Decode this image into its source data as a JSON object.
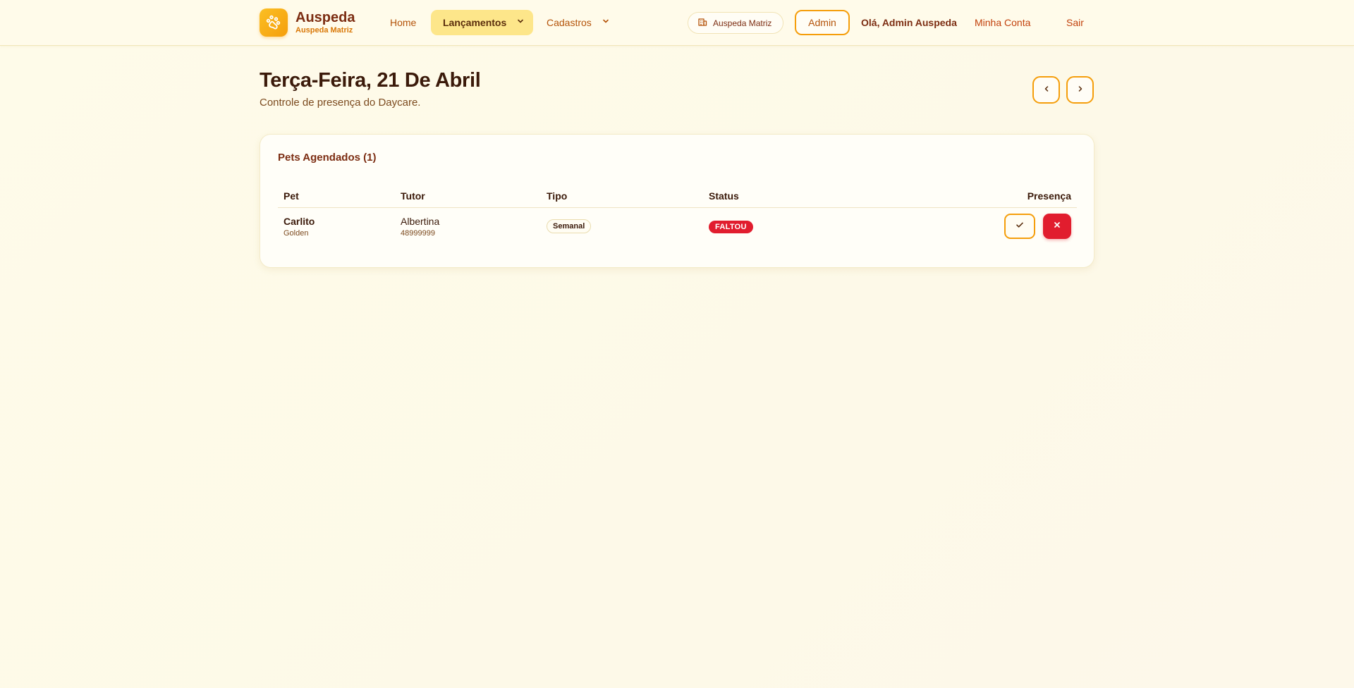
{
  "brand": {
    "name": "Auspeda",
    "subtitle": "Auspeda Matriz",
    "logo_icon": "paw-icon"
  },
  "nav": {
    "home": "Home",
    "lancamentos": "Lançamentos",
    "cadastros": "Cadastros"
  },
  "header": {
    "branch": "Auspeda Matriz",
    "role": "Admin",
    "greeting": "Olá, Admin Auspeda",
    "account": "Minha Conta",
    "logout": "Sair"
  },
  "page": {
    "title": "Terça-Feira, 21 De Abril",
    "subtitle": "Controle de presença do Daycare."
  },
  "card": {
    "title": "Pets Agendados (1)",
    "columns": {
      "pet": "Pet",
      "tutor": "Tutor",
      "type": "Tipo",
      "status": "Status",
      "presence": "Presença"
    },
    "rows": [
      {
        "pet_name": "Carlito",
        "pet_breed": "Golden",
        "tutor_name": "Albertina",
        "tutor_phone": "48999999",
        "type": "Semanal",
        "status": "FALTOU"
      }
    ]
  },
  "colors": {
    "accent": "#f59e0b",
    "accent_light": "#fde68a",
    "danger": "#e11d2e",
    "brand_text": "#7c2d12",
    "background": "#fefbe9"
  }
}
